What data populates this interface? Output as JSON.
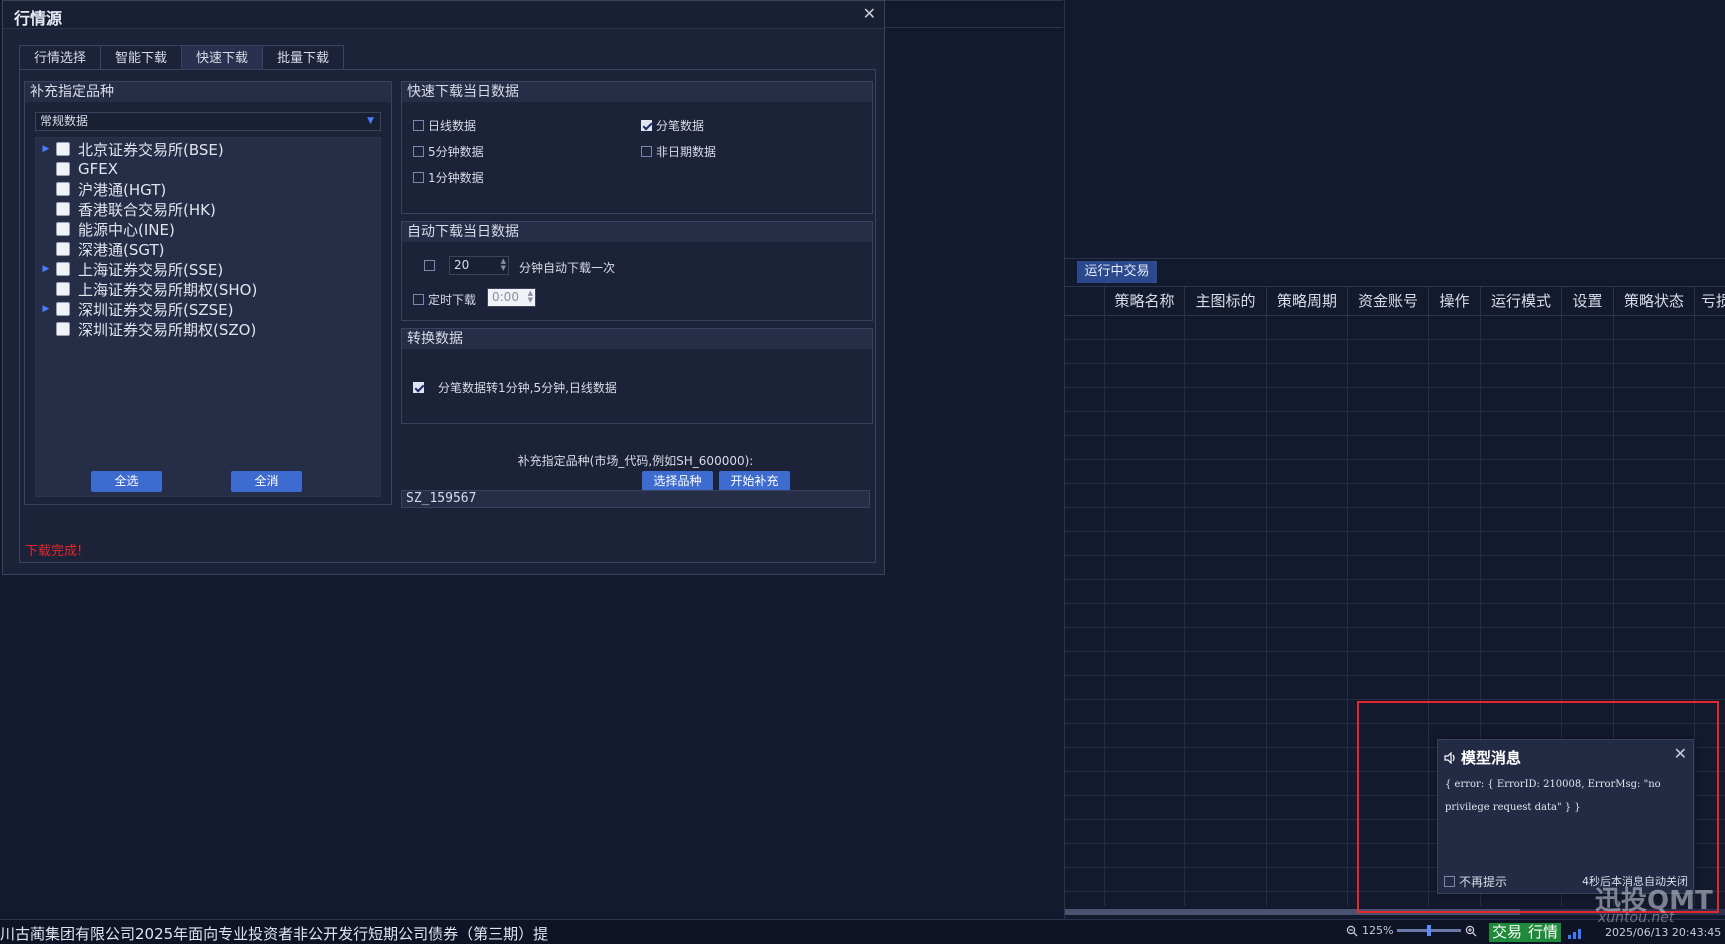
{
  "dialog": {
    "title": "行情源",
    "tabs": [
      {
        "label": "行情选择"
      },
      {
        "label": "智能下载"
      },
      {
        "label": "快速下载"
      },
      {
        "label": "批量下载"
      }
    ],
    "active_tab": "快速下载"
  },
  "supplement": {
    "title": "补充指定品种",
    "dropdown_value": "常规数据",
    "tree_items": [
      {
        "label": "北京证券交易所(BSE)",
        "expandable": true
      },
      {
        "label": "GFEX",
        "expandable": false
      },
      {
        "label": "沪港通(HGT)",
        "expandable": false
      },
      {
        "label": "香港联合交易所(HK)",
        "expandable": false
      },
      {
        "label": "能源中心(INE)",
        "expandable": false
      },
      {
        "label": "深港通(SGT)",
        "expandable": false
      },
      {
        "label": "上海证券交易所(SSE)",
        "expandable": true
      },
      {
        "label": "上海证券交易所期权(SHO)",
        "expandable": false
      },
      {
        "label": "深圳证券交易所(SZSE)",
        "expandable": true
      },
      {
        "label": "深圳证券交易所期权(SZO)",
        "expandable": false
      }
    ],
    "select_all_label": "全选",
    "deselect_all_label": "全消"
  },
  "quick_download": {
    "title": "快速下载当日数据",
    "options": {
      "daily": {
        "label": "日线数据",
        "checked": false
      },
      "tick": {
        "label": "分笔数据",
        "checked": true
      },
      "min5": {
        "label": "5分钟数据",
        "checked": false
      },
      "nondate": {
        "label": "非日期数据",
        "checked": false
      },
      "min1": {
        "label": "1分钟数据",
        "checked": false
      }
    }
  },
  "auto_download": {
    "title": "自动下载当日数据",
    "interval_value": "20",
    "interval_label": "分钟自动下载一次",
    "timed_label": "定时下载",
    "timed_value": "0:00"
  },
  "convert": {
    "title": "转换数据",
    "option_label": "分笔数据转1分钟,5分钟,日线数据"
  },
  "code_entry": {
    "hint": "补充指定品种(市场_代码,例如SH_600000):",
    "value": "SZ_159567",
    "select_button": "选择品种",
    "start_button": "开始补充"
  },
  "status_message": "下载完成!",
  "strategy_panel": {
    "tab_label": "运行中交易",
    "columns": [
      "策略名称",
      "主图标的",
      "策略周期",
      "资金账号",
      "操作",
      "运行模式",
      "设置",
      "策略状态",
      "亏损"
    ]
  },
  "popup": {
    "title": "模型消息",
    "message": "{ error: { ErrorID: 210008, ErrorMsg: \"no privilege request data\" } }",
    "dont_show_label": "不再提示",
    "auto_close_text": "4秒后本消息自动关闭"
  },
  "statusbar": {
    "ticker": "川古蔺集团有限公司2025年面向专业投资者非公开发行短期公司债券（第三期）提",
    "zoom_level": "125%",
    "trade_badge": "交易",
    "quote_badge": "行情",
    "datetime": "2025/06/13 20:43:45"
  },
  "watermark": {
    "main": "迅投QMT",
    "sub": "xuntou.net"
  },
  "colors": {
    "accent": "#3e6bd0",
    "error": "#e5262a",
    "badge_green": "#1f8a3a"
  }
}
